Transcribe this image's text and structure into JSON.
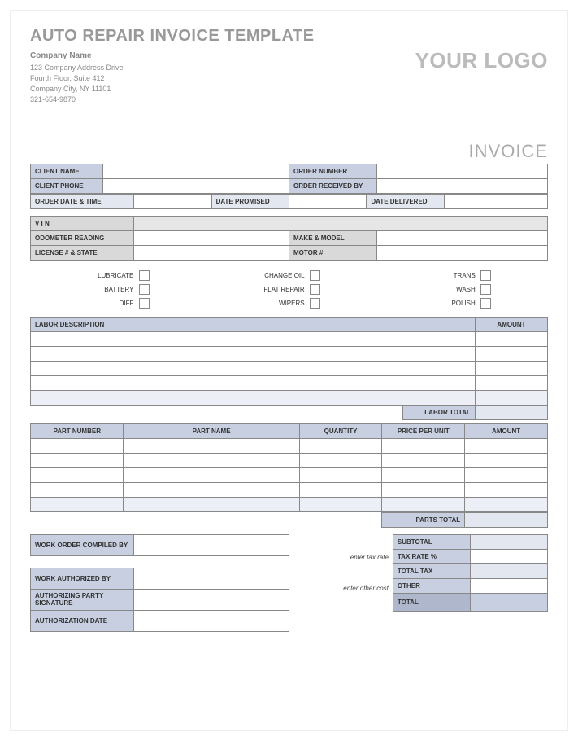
{
  "title": "AUTO REPAIR INVOICE TEMPLATE",
  "company": {
    "name": "Company Name",
    "line1": "123 Company Address Drive",
    "line2": "Fourth Floor, Suite 412",
    "line3": "Company City, NY  11101",
    "phone": "321-654-9870"
  },
  "logo": "YOUR LOGO",
  "heading": "INVOICE",
  "client_section": {
    "client_name": "CLIENT NAME",
    "client_phone": "CLIENT PHONE",
    "order_number": "ORDER NUMBER",
    "order_received_by": "ORDER RECEIVED BY",
    "order_date_time": "ORDER DATE & TIME",
    "date_promised": "DATE PROMISED",
    "date_delivered": "DATE DELIVERED"
  },
  "vehicle_section": {
    "vin": "V I N",
    "odometer": "ODOMETER READING",
    "make_model": "MAKE & MODEL",
    "license": "LICENSE # & STATE",
    "motor": "MOTOR #"
  },
  "checks": {
    "c1": "LUBRICATE",
    "c2": "CHANGE OIL",
    "c3": "TRANS",
    "c4": "BATTERY",
    "c5": "FLAT REPAIR",
    "c6": "WASH",
    "c7": "DIFF",
    "c8": "WIPERS",
    "c9": "POLISH"
  },
  "labor": {
    "desc": "LABOR DESCRIPTION",
    "amount": "AMOUNT",
    "total": "LABOR TOTAL"
  },
  "parts": {
    "part_no": "PART NUMBER",
    "part_name": "PART NAME",
    "qty": "QUANTITY",
    "ppu": "PRICE PER UNIT",
    "amount": "AMOUNT",
    "total": "PARTS TOTAL"
  },
  "footer": {
    "work_order": "WORK ORDER COMPILED BY",
    "work_auth_by": "WORK AUTHORIZED BY",
    "auth_sig": "AUTHORIZING PARTY SIGNATURE",
    "auth_date": "AUTHORIZATION DATE",
    "enter_tax": "enter tax rate",
    "enter_other": "enter other cost"
  },
  "summary": {
    "subtotal": "SUBTOTAL",
    "tax_rate": "TAX RATE %",
    "total_tax": "TOTAL TAX",
    "other": "OTHER",
    "total": "TOTAL"
  }
}
